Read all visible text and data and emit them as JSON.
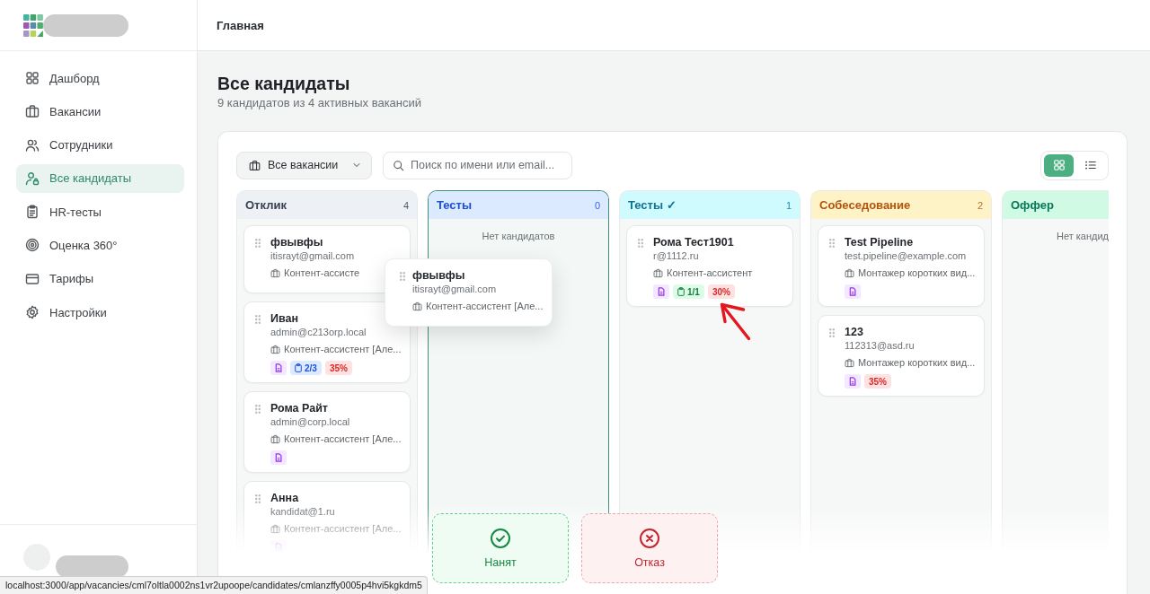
{
  "sidebar": {
    "items": [
      {
        "label": "Дашборд",
        "selected": false
      },
      {
        "label": "Вакансии",
        "selected": false
      },
      {
        "label": "Сотрудники",
        "selected": false
      },
      {
        "label": "Все кандидаты",
        "selected": true
      },
      {
        "label": "HR-тесты",
        "selected": false
      },
      {
        "label": "Оценка 360°",
        "selected": false
      },
      {
        "label": "Тарифы",
        "selected": false
      },
      {
        "label": "Настройки",
        "selected": false
      }
    ]
  },
  "header": {
    "breadcrumb": "Главная"
  },
  "page": {
    "title": "Все кандидаты",
    "subtitle": "9 кандидатов из 4 активных вакансий"
  },
  "toolbar": {
    "vacancy_filter": "Все вакансии",
    "search": {
      "placeholder": "Поиск по имени или email..."
    },
    "views": [
      {
        "kind": "grid",
        "selected": true
      },
      {
        "kind": "list",
        "selected": false
      }
    ]
  },
  "columns": [
    {
      "header": {
        "color": "#edf1f5",
        "title": {
          "text": "Отклик",
          "color": "#374151"
        },
        "count": "4"
      },
      "drop_target": false,
      "cards": [
        {
          "name": "фвывфы",
          "email": "itisrayt@gmail.com",
          "vacancy": "Контент-ассисте"
        },
        {
          "name": "Иван",
          "email": "admin@c213orp.local",
          "vacancy": "Контент-ассистент [Але...",
          "badges": [
            {
              "kind": "resume"
            },
            {
              "kind": "tests",
              "text": "2/3",
              "complete": false
            },
            {
              "kind": "score",
              "text": "35%"
            }
          ]
        },
        {
          "name": "Рома Райт",
          "email": "admin@corp.local",
          "vacancy": "Контент-ассистент [Але...",
          "badges": [
            {
              "kind": "resume"
            }
          ]
        },
        {
          "name": "Анна",
          "email": "kandidat@1.ru",
          "vacancy": "Контент-ассистент [Але...",
          "badges": [
            {
              "kind": "resume"
            }
          ]
        }
      ]
    },
    {
      "header": {
        "color": "#dbeafe",
        "title": {
          "text": "Тесты",
          "color": "#1d4ed8"
        },
        "count": "0"
      },
      "drop_target": true,
      "empty_text": "Нет кандидатов"
    },
    {
      "header": {
        "color": "#cffafe",
        "title": {
          "text": "Тесты ✓",
          "color": "#0e7490"
        },
        "count": "1"
      },
      "drop_target": false,
      "cards": [
        {
          "name": "Рома Тест1901",
          "email": "r@1112.ru",
          "vacancy": "Контент-ассистент",
          "badges": [
            {
              "kind": "resume"
            },
            {
              "kind": "tests",
              "text": "1/1",
              "complete": true
            },
            {
              "kind": "score",
              "text": "30%"
            }
          ]
        }
      ]
    },
    {
      "header": {
        "color": "#fef3c7",
        "title": {
          "text": "Собеседование",
          "color": "#b45309"
        },
        "count": "2"
      },
      "drop_target": false,
      "cards": [
        {
          "name": "Test Pipeline",
          "email": "test.pipeline@example.com",
          "vacancy": "Монтажер коротких вид...",
          "badges": [
            {
              "kind": "resume"
            }
          ]
        },
        {
          "name": "123",
          "email": "112313@asd.ru",
          "vacancy": "Монтажер коротких вид...",
          "badges": [
            {
              "kind": "resume"
            },
            {
              "kind": "score",
              "text": "35%"
            }
          ]
        }
      ]
    },
    {
      "header": {
        "color": "#d1fae5",
        "title": {
          "text": "Оффер",
          "color": "#047857"
        }
      },
      "drop_target": false,
      "empty_text": "Нет кандид"
    }
  ],
  "drag_card": {
    "name": "фвывфы",
    "email": "itisrayt@gmail.com",
    "vacancy": "Контент-ассистент [Але..."
  },
  "drop_zones": [
    {
      "kind": "hired",
      "label": "Нанят"
    },
    {
      "kind": "rejected",
      "label": "Отказ"
    }
  ],
  "status_bar": {
    "url": "localhost:3000/app/vacancies/cml7oltla0002ns1vr2upoope/candidates/cmlanzffy0005p4hvi5kgkdm5"
  }
}
